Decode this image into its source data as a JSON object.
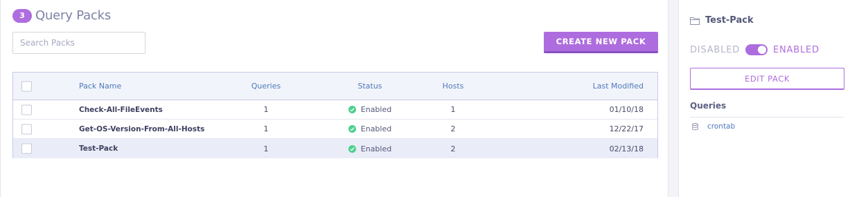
{
  "header": {
    "count": "3",
    "title": "Query Packs"
  },
  "search": {
    "placeholder": "Search Packs",
    "value": ""
  },
  "create_button": "CREATE NEW PACK",
  "table": {
    "columns": [
      "Pack Name",
      "Queries",
      "Status",
      "Hosts",
      "Last Modified"
    ],
    "rows": [
      {
        "name": "Check-All-FileEvents",
        "queries": "1",
        "status": "Enabled",
        "hosts": "1",
        "modified": "01/10/18"
      },
      {
        "name": "Get-OS-Version-From-All-Hosts",
        "queries": "1",
        "status": "Enabled",
        "hosts": "2",
        "modified": "12/22/17"
      },
      {
        "name": "Test-Pack",
        "queries": "1",
        "status": "Enabled",
        "hosts": "2",
        "modified": "02/13/18"
      }
    ]
  },
  "sidebar": {
    "pack_name": "Test-Pack",
    "toggle": {
      "off_label": "DISABLED",
      "on_label": "ENABLED",
      "state": "enabled"
    },
    "edit_button": "EDIT PACK",
    "queries_heading": "Queries",
    "queries": [
      "crontab"
    ]
  },
  "colors": {
    "accent": "#ae6ddf",
    "link": "#4e79ba",
    "status_enabled": "#4bd08f"
  },
  "icons": {
    "status": "check-circle-icon",
    "pack": "folder-icon",
    "query": "database-icon"
  }
}
